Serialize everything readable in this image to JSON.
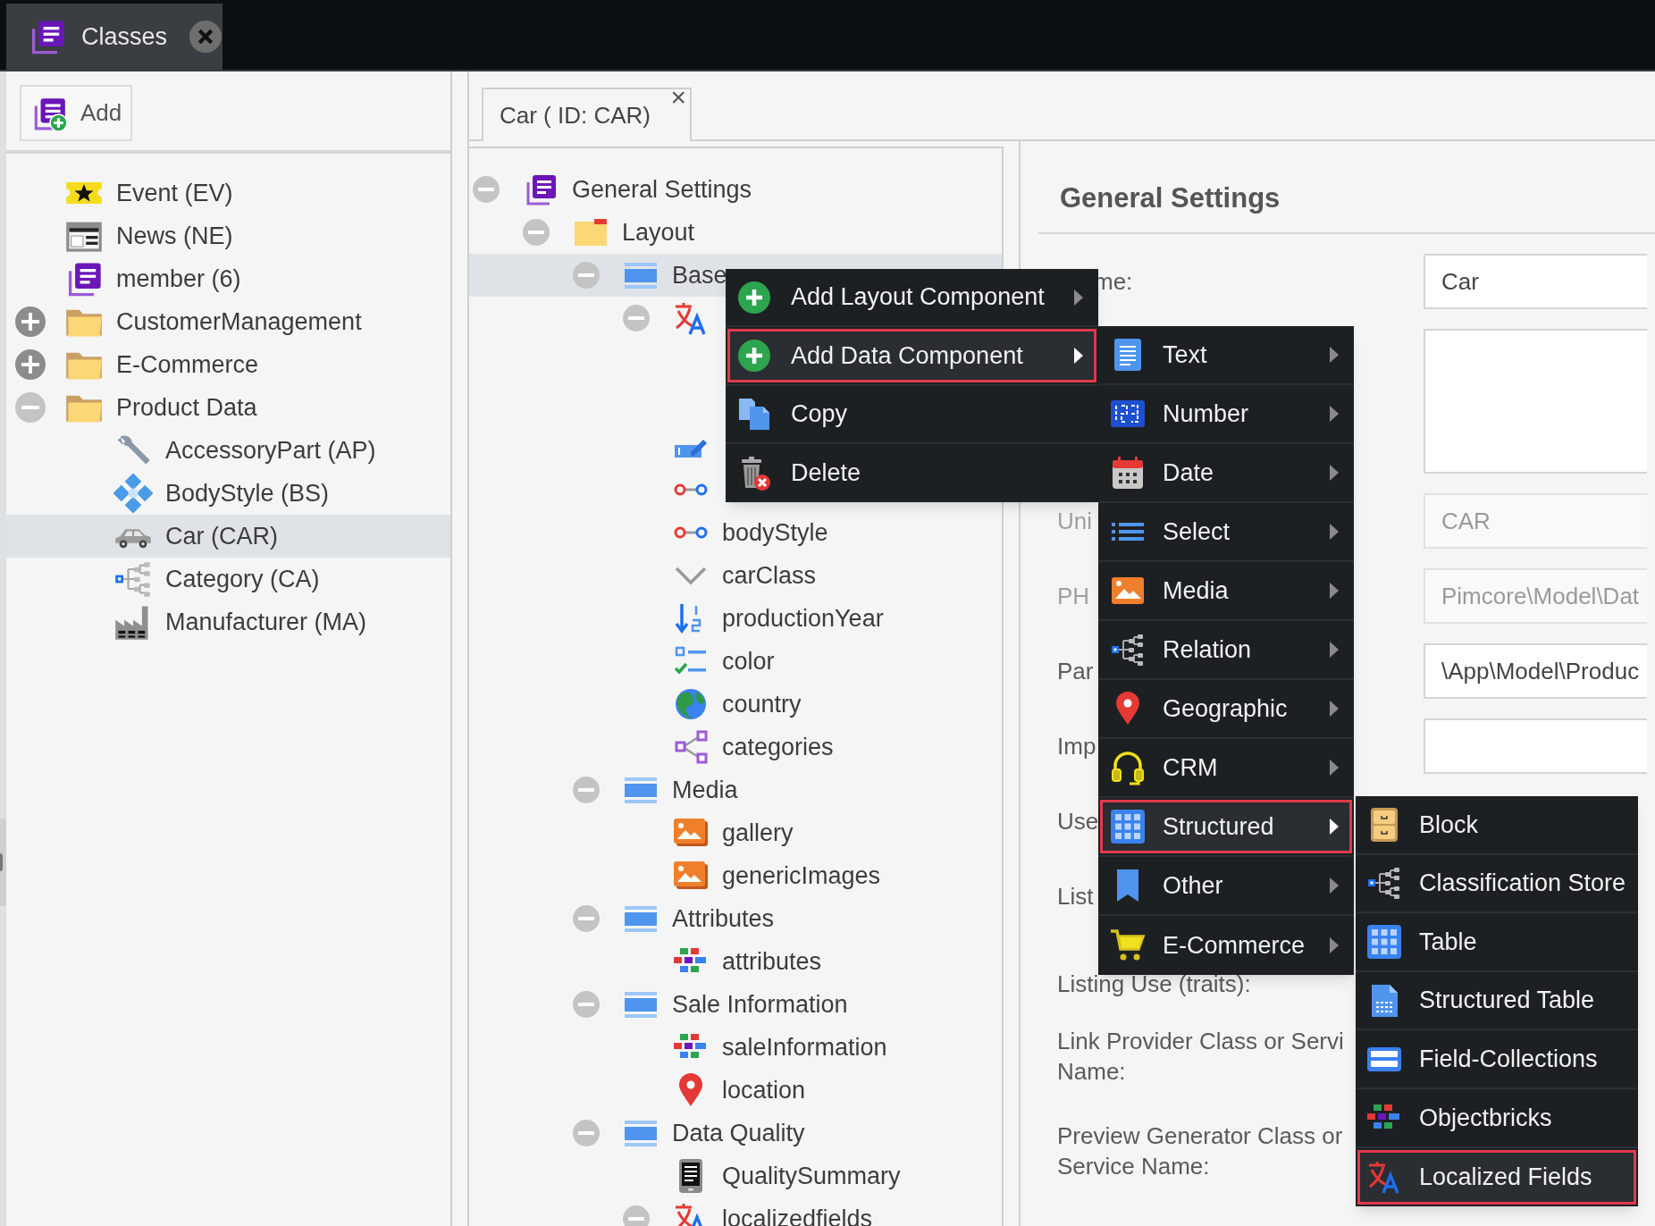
{
  "top_tabs": [
    {
      "label": "Classes",
      "selected": true
    }
  ],
  "toolbar": {
    "add_button": "Add"
  },
  "class_tree": [
    {
      "label": "Event (EV)",
      "kind": "event",
      "selected": false
    },
    {
      "label": "News (NE)",
      "kind": "news",
      "selected": false
    },
    {
      "label": "member (6)",
      "kind": "class",
      "selected": false
    },
    {
      "label": "CustomerManagement",
      "kind": "folder",
      "expanded": false,
      "selected": false
    },
    {
      "label": "E-Commerce",
      "kind": "folder",
      "expanded": false,
      "selected": false
    },
    {
      "label": "Product Data",
      "kind": "folder",
      "expanded": true,
      "selected": false,
      "children": [
        {
          "label": "AccessoryPart (AP)",
          "kind": "accessory",
          "selected": false
        },
        {
          "label": "BodyStyle (BS)",
          "kind": "bodystyle",
          "selected": false
        },
        {
          "label": "Car (CAR)",
          "kind": "car",
          "selected": true
        },
        {
          "label": "Category (CA)",
          "kind": "category",
          "selected": false
        },
        {
          "label": "Manufacturer (MA)",
          "kind": "manufacturer",
          "selected": false
        }
      ]
    }
  ],
  "editor_tabs": [
    {
      "label": "Car ( ID: CAR)",
      "close": "×",
      "selected": true
    }
  ],
  "layout_tree": [
    {
      "label": "General Settings",
      "kind": "class",
      "expanded": true,
      "selected": false,
      "children": [
        {
          "label": "Layout",
          "kind": "layout",
          "expanded": true,
          "selected": false,
          "children": [
            {
              "label": "Base",
              "kind": "panel",
              "expanded": true,
              "selected": true,
              "children": [
                {
                  "kind": "localizedfields",
                  "expanded": true,
                  "selected": false
                },
                {
                  "kind": "input",
                  "selected": false
                },
                {
                  "kind": "relation",
                  "selected": false
                },
                {
                  "label": "bodyStyle",
                  "kind": "relation",
                  "selected": false
                },
                {
                  "label": "carClass",
                  "kind": "select",
                  "selected": false
                },
                {
                  "label": "productionYear",
                  "kind": "numeric",
                  "selected": false
                },
                {
                  "label": "color",
                  "kind": "multiselect",
                  "selected": false
                },
                {
                  "label": "country",
                  "kind": "country",
                  "selected": false
                },
                {
                  "label": "categories",
                  "kind": "relations",
                  "selected": false
                }
              ]
            },
            {
              "label": "Media",
              "kind": "panel",
              "expanded": true,
              "selected": false,
              "children": [
                {
                  "label": "gallery",
                  "kind": "image",
                  "selected": false
                },
                {
                  "label": "genericImages",
                  "kind": "image",
                  "selected": false
                }
              ]
            },
            {
              "label": "Attributes",
              "kind": "panel",
              "expanded": true,
              "selected": false,
              "children": [
                {
                  "label": "attributes",
                  "kind": "objectbricks",
                  "selected": false
                }
              ]
            },
            {
              "label": "Sale Information",
              "kind": "panel",
              "expanded": true,
              "selected": false,
              "children": [
                {
                  "label": "saleInformation",
                  "kind": "objectbricks",
                  "selected": false
                },
                {
                  "label": "location",
                  "kind": "geopoint",
                  "selected": false
                }
              ]
            },
            {
              "label": "Data Quality",
              "kind": "panel",
              "expanded": true,
              "selected": false,
              "children": [
                {
                  "label": "QualitySummary",
                  "kind": "tablet",
                  "selected": false
                },
                {
                  "label": "localizedfields",
                  "kind": "localizedfields",
                  "expanded": true,
                  "selected": false
                }
              ]
            }
          ]
        }
      ]
    }
  ],
  "form": {
    "title": "General Settings",
    "rows": [
      {
        "kind": "input",
        "label": "me:",
        "value": "Car",
        "disabled": false
      },
      {
        "kind": "textarea"
      },
      {
        "kind": "input",
        "label": "Uni",
        "value": "CAR",
        "disabled": true
      },
      {
        "kind": "input",
        "label": "PH",
        "value": "Pimcore\\Model\\Dat",
        "disabled": true
      },
      {
        "kind": "input",
        "label": "Par",
        "value": "\\App\\Model\\Produc",
        "disabled": false
      },
      {
        "kind": "input",
        "label": "Imp",
        "disabled": false
      },
      {
        "kind": "label",
        "label": "Use"
      },
      {
        "kind": "label",
        "label": "List"
      },
      {
        "kind": "label_low",
        "label": "Listing Use (traits):"
      },
      {
        "kind": "multiline",
        "label": "Link Provider Class or Servi\nName:"
      },
      {
        "kind": "multiline",
        "label": "Preview Generator Class or\nService Name:"
      }
    ]
  },
  "context_menu": [
    {
      "label": "Add Layout Component",
      "kind": "add",
      "submenu": true,
      "selected": false
    },
    {
      "label": "Add Data Component",
      "kind": "add",
      "submenu": true,
      "selected": true
    },
    {
      "label": "Copy",
      "kind": "copy",
      "submenu": false,
      "selected": false
    },
    {
      "label": "Delete",
      "kind": "delete",
      "submenu": false,
      "selected": false
    }
  ],
  "data_component_menu": [
    {
      "label": "Text",
      "kind": "text",
      "submenu": true,
      "selected": false
    },
    {
      "label": "Number",
      "kind": "number",
      "submenu": true,
      "selected": false
    },
    {
      "label": "Date",
      "kind": "date",
      "submenu": true,
      "selected": false
    },
    {
      "label": "Select",
      "kind": "select_list",
      "submenu": true,
      "selected": false
    },
    {
      "label": "Media",
      "kind": "media",
      "submenu": true,
      "selected": false
    },
    {
      "label": "Relation",
      "kind": "category",
      "submenu": true,
      "selected": false
    },
    {
      "label": "Geographic",
      "kind": "geopoint",
      "submenu": true,
      "selected": false
    },
    {
      "label": "CRM",
      "kind": "crm",
      "submenu": true,
      "selected": false
    },
    {
      "label": "Structured",
      "kind": "grid",
      "submenu": true,
      "selected": true
    },
    {
      "label": "Other",
      "kind": "other",
      "submenu": true,
      "selected": false
    },
    {
      "label": "E-Commerce",
      "kind": "cart",
      "submenu": true,
      "selected": false
    }
  ],
  "structured_menu": [
    {
      "label": "Block",
      "kind": "block",
      "selected": false
    },
    {
      "label": "Classification Store",
      "kind": "category",
      "selected": false
    },
    {
      "label": "Table",
      "kind": "grid",
      "selected": false
    },
    {
      "label": "Structured Table",
      "kind": "structuredtable",
      "selected": false
    },
    {
      "label": "Field-Collections",
      "kind": "fieldcollections",
      "selected": false
    },
    {
      "label": "Objectbricks",
      "kind": "objectbricks",
      "selected": false
    },
    {
      "label": "Localized Fields",
      "kind": "localizedfields",
      "selected": true
    }
  ]
}
